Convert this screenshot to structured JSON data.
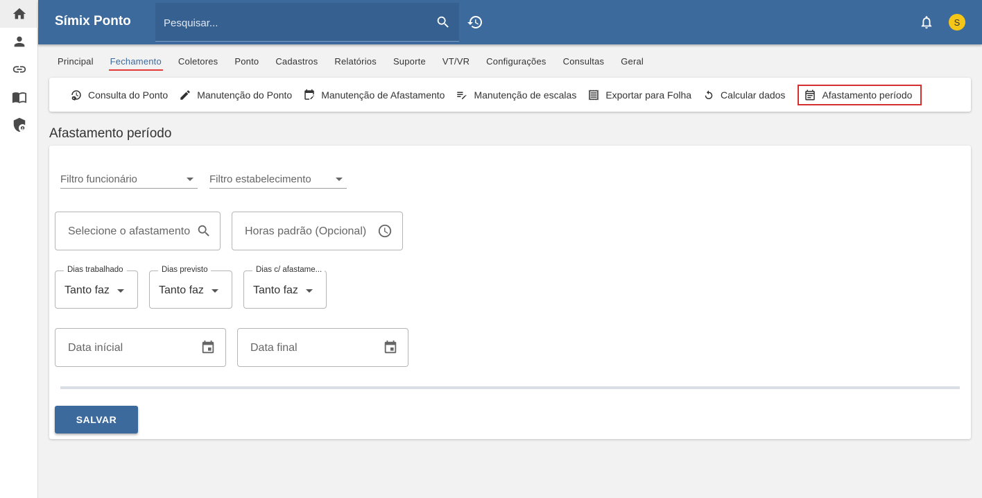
{
  "rail": {
    "items": [
      {
        "icon": "home-icon"
      },
      {
        "icon": "person-icon"
      },
      {
        "icon": "link-icon"
      },
      {
        "icon": "book-icon"
      },
      {
        "icon": "security-icon"
      }
    ]
  },
  "topbar": {
    "title": "Símix Ponto",
    "search_placeholder": "Pesquisar...",
    "avatar_initial": "S",
    "colors": {
      "bar": "#3c6a9c",
      "avatar": "#f5c518"
    }
  },
  "menu": {
    "items": [
      "Principal",
      "Fechamento",
      "Coletores",
      "Ponto",
      "Cadastros",
      "Relatórios",
      "Suporte",
      "VT/VR",
      "Configurações",
      "Consultas",
      "Geral"
    ],
    "active": "Fechamento"
  },
  "submenu": {
    "items": [
      {
        "label": "Consulta do Ponto",
        "icon": "clock-settings-icon"
      },
      {
        "label": "Manutenção do Ponto",
        "icon": "pencil-icon"
      },
      {
        "label": "Manutenção de Afastamento",
        "icon": "calendar-edit-icon"
      },
      {
        "label": "Manutenção de escalas",
        "icon": "list-edit-icon"
      },
      {
        "label": "Exportar para Folha",
        "icon": "receipt-icon"
      },
      {
        "label": "Calcular dados",
        "icon": "refresh-icon"
      },
      {
        "label": "Afastamento período",
        "icon": "calendar-icon"
      }
    ],
    "highlighted": "Afastamento período"
  },
  "page": {
    "title": "Afastamento período"
  },
  "form": {
    "filtro_funcionario": "Filtro funcionário",
    "filtro_estabelecimento": "Filtro estabelecimento",
    "afastamento_placeholder": "Selecione o afastamento",
    "horas_placeholder": "Horas padrão (Opcional)",
    "dias_trabalhado": {
      "label": "Dias trabalhado",
      "value": "Tanto faz"
    },
    "dias_previsto": {
      "label": "Dias previsto",
      "value": "Tanto faz"
    },
    "dias_afastamento": {
      "label": "Dias c/ afastame...",
      "value": "Tanto faz"
    },
    "data_inicial_placeholder": "Data inícial",
    "data_final_placeholder": "Data final",
    "save_label": "SALVAR"
  }
}
